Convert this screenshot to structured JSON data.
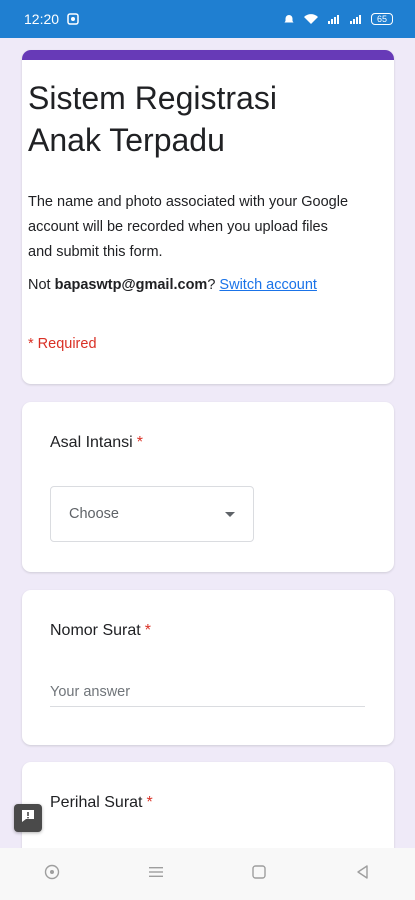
{
  "status_bar": {
    "time": "12:20",
    "battery": "65",
    "colors": {
      "background": "#1f7fd1"
    }
  },
  "form": {
    "accent_color": "#673ab7",
    "title": "Sistem Registrasi Anak Terpadu",
    "description": "The name and photo associated with your Google account will be recorded when you upload files and submit this form.",
    "account_prefix": "Not ",
    "account_email": "bapaswtp@gmail.com",
    "account_suffix": "? ",
    "switch_account_label": "Switch account",
    "required_note": "* Required"
  },
  "questions": [
    {
      "title": "Asal Intansi",
      "required_mark": "*",
      "type": "dropdown",
      "selected_value": "Choose"
    },
    {
      "title": "Nomor Surat",
      "required_mark": "*",
      "type": "short_answer",
      "placeholder": "Your answer"
    },
    {
      "title": "Perihal Surat",
      "required_mark": "*",
      "type": "short_answer"
    }
  ],
  "icons": {
    "feedback": "feedback-icon",
    "nav": [
      "assistant-circle-icon",
      "menu-icon",
      "home-square-icon",
      "back-triangle-icon"
    ]
  }
}
